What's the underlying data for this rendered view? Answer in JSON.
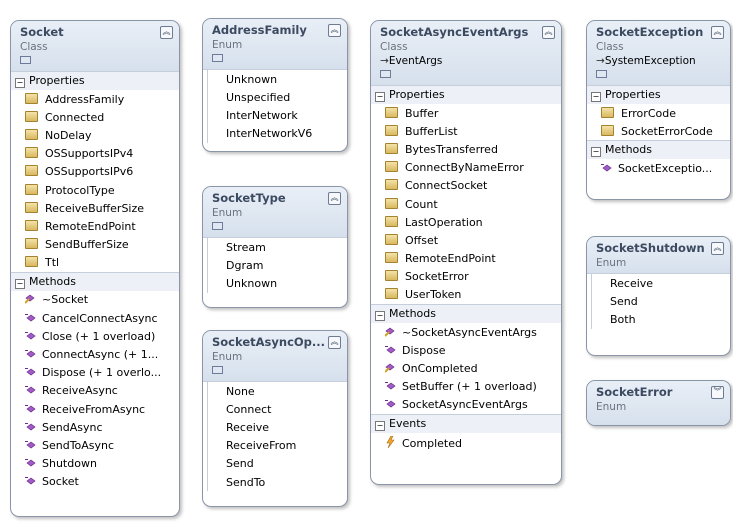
{
  "boxes": {
    "socket": {
      "title": "Socket",
      "kind": "Class",
      "properties_label": "Properties",
      "properties": [
        "AddressFamily",
        "Connected",
        "NoDelay",
        "OSSupportsIPv4",
        "OSSupportsIPv6",
        "ProtocolType",
        "ReceiveBufferSize",
        "RemoteEndPoint",
        "SendBufferSize",
        "Ttl"
      ],
      "methods_label": "Methods",
      "methods": [
        "~Socket",
        "CancelConnectAsync",
        "Close (+ 1 overload)",
        "ConnectAsync (+ 1...",
        "Dispose (+ 1 overlo...",
        "ReceiveAsync",
        "ReceiveFromAsync",
        "SendAsync",
        "SendToAsync",
        "Shutdown",
        "Socket"
      ]
    },
    "address_family": {
      "title": "AddressFamily",
      "kind": "Enum",
      "values": [
        "Unknown",
        "Unspecified",
        "InterNetwork",
        "InterNetworkV6"
      ]
    },
    "socket_type": {
      "title": "SocketType",
      "kind": "Enum",
      "values": [
        "Stream",
        "Dgram",
        "Unknown"
      ]
    },
    "socket_async_op": {
      "title": "SocketAsyncOp...",
      "kind": "Enum",
      "values": [
        "None",
        "Connect",
        "Receive",
        "ReceiveFrom",
        "Send",
        "SendTo"
      ]
    },
    "saea": {
      "title": "SocketAsyncEventArgs",
      "kind": "Class",
      "base": "EventArgs",
      "properties_label": "Properties",
      "properties": [
        "Buffer",
        "BufferList",
        "BytesTransferred",
        "ConnectByNameError",
        "ConnectSocket",
        "Count",
        "LastOperation",
        "Offset",
        "RemoteEndPoint",
        "SocketError",
        "UserToken"
      ],
      "methods_label": "Methods",
      "methods": [
        "~SocketAsyncEventArgs",
        "Dispose",
        "OnCompleted",
        "SetBuffer (+ 1 overload)",
        "SocketAsyncEventArgs"
      ],
      "events_label": "Events",
      "events": [
        "Completed"
      ]
    },
    "socket_exception": {
      "title": "SocketException",
      "kind": "Class",
      "base": "SystemException",
      "properties_label": "Properties",
      "properties": [
        "ErrorCode",
        "SocketErrorCode"
      ],
      "methods_label": "Methods",
      "methods": [
        "SocketExceptio..."
      ]
    },
    "socket_shutdown": {
      "title": "SocketShutdown",
      "kind": "Enum",
      "values": [
        "Receive",
        "Send",
        "Both"
      ]
    },
    "socket_error": {
      "title": "SocketError",
      "kind": "Enum"
    }
  },
  "colors": {
    "header": "#dce5f0",
    "border": "#8a96a8",
    "title": "#3b4a60",
    "method_icon": "#a25bc6"
  },
  "icons": {
    "property": "property-icon",
    "method": "method-icon",
    "event": "event-icon",
    "collapse": "collapse-chevron-icon",
    "expand": "expand-chevron-icon"
  }
}
